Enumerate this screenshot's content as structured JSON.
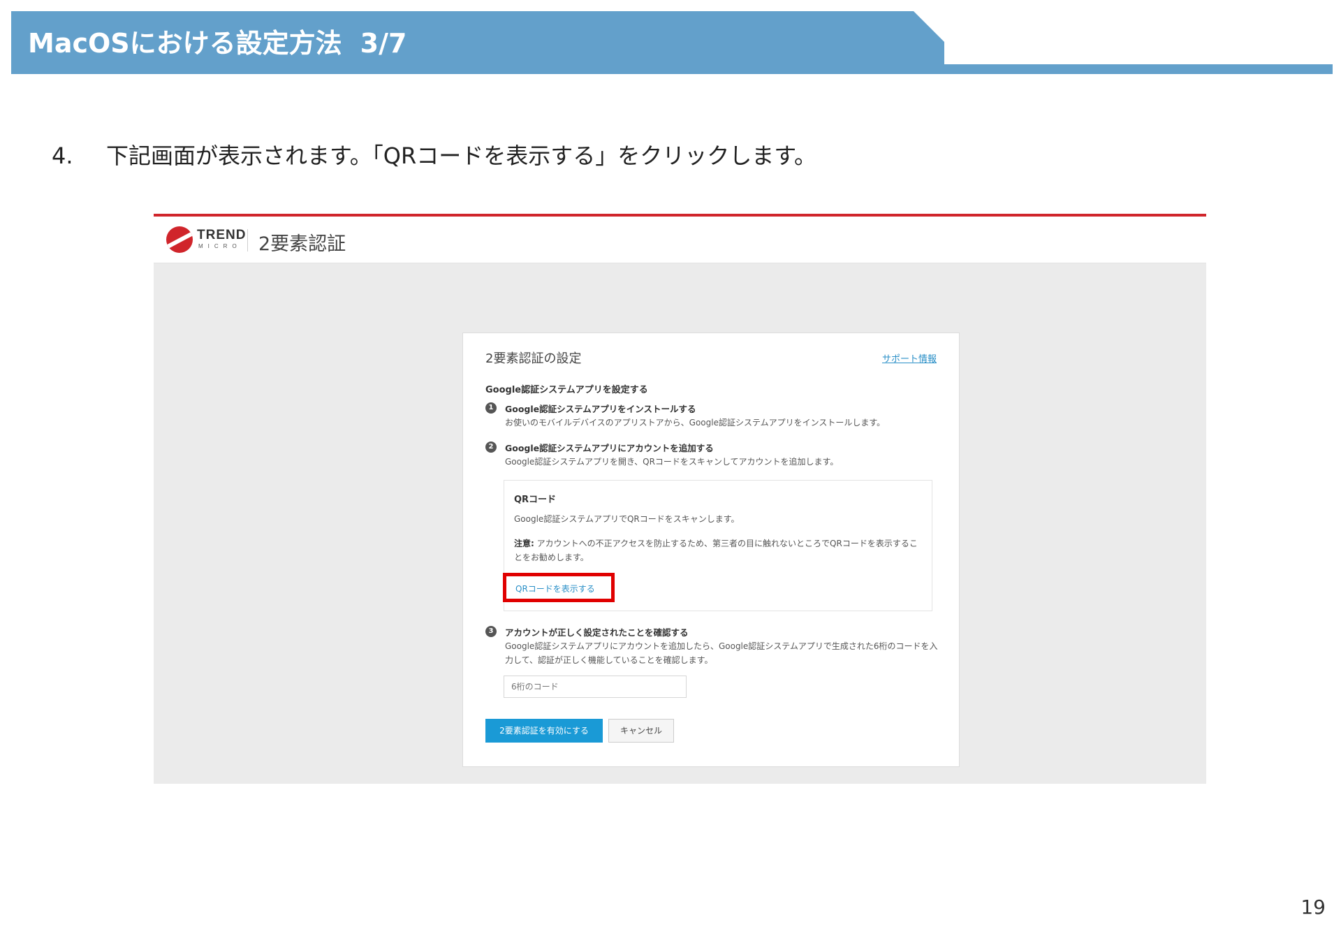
{
  "slide": {
    "title": "MacOSにおける設定方法",
    "title_page": "3/7",
    "step_number": "4.",
    "step_text": "下記画面が表示されます。「QRコードを表示する」をクリックします。",
    "page_number": "19"
  },
  "app": {
    "logo_text": "TREND",
    "logo_sub": "MICRO",
    "title": "2要素認証"
  },
  "card": {
    "title": "2要素認証の設定",
    "support_link": "サポート情報",
    "section_title": "Google認証システムアプリを設定する",
    "steps": [
      {
        "badge": "1",
        "head": "Google認証システムアプリをインストールする",
        "desc": "お使いのモバイルデバイスのアプリストアから、Google認証システムアプリをインストールします。"
      },
      {
        "badge": "2",
        "head": "Google認証システムアプリにアカウントを追加する",
        "desc": "Google認証システムアプリを開き、QRコードをスキャンしてアカウントを追加します。"
      },
      {
        "badge": "3",
        "head": "アカウントが正しく設定されたことを確認する",
        "desc": "Google認証システムアプリにアカウントを追加したら、Google認証システムアプリで生成された6桁のコードを入力して、認証が正しく機能していることを確認します。"
      }
    ],
    "qr": {
      "title": "QRコード",
      "desc": "Google認証システムアプリでQRコードをスキャンします。",
      "note_label": "注意:",
      "note": "アカウントへの不正アクセスを防止するため、第三者の目に触れないところでQRコードを表示することをお勧めします。",
      "link": "QRコードを表示する"
    },
    "code_placeholder": "6桁のコード",
    "enable_button": "2要素認証を有効にする",
    "cancel_button": "キャンセル"
  },
  "colors": {
    "title_bar": "#63a0cb",
    "brand_red": "#d0252b",
    "highlight": "#e00000",
    "primary_button": "#1a9ad6",
    "link": "#2a8fc7"
  }
}
